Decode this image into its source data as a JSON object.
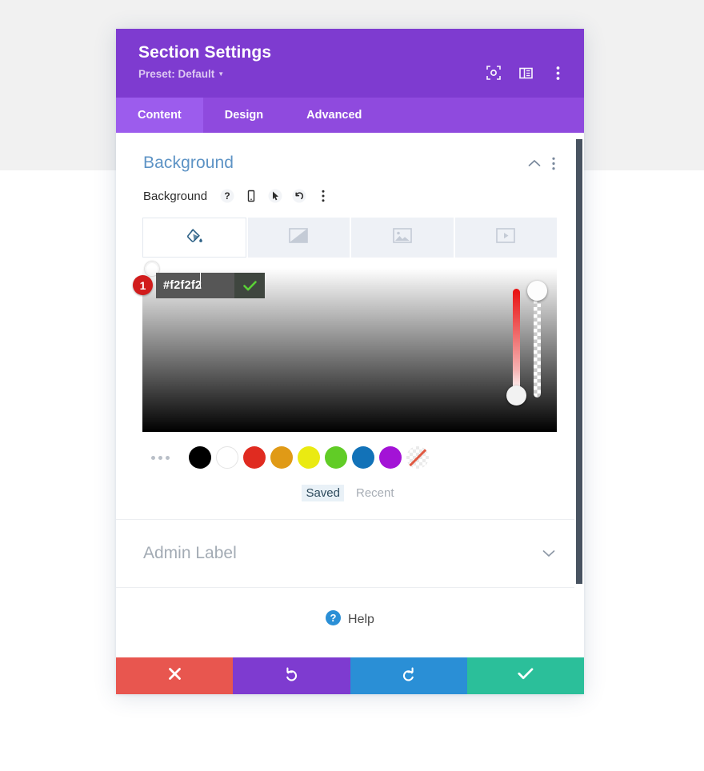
{
  "page": {
    "band_top_color": "#f1f1f1",
    "band_bottom_color": "#ffffff"
  },
  "modal": {
    "header": {
      "title": "Section Settings",
      "preset_label": "Preset: Default",
      "bg_color": "#7e3bd0",
      "icons": [
        {
          "name": "focus-expand-icon"
        },
        {
          "name": "layout-panel-icon"
        },
        {
          "name": "more-vertical-icon"
        }
      ]
    },
    "tabs": [
      {
        "label": "Content",
        "active": true
      },
      {
        "label": "Design",
        "active": false
      },
      {
        "label": "Advanced",
        "active": false
      }
    ],
    "tab_bar_color": "#8f4ade",
    "tab_active_color": "#9c5ced"
  },
  "background_section": {
    "title": "Background",
    "title_color": "#5d93c5",
    "collapse_icon": "chevron-up-icon",
    "more_icon": "more-vertical-icon",
    "field": {
      "label": "Background",
      "icons": [
        {
          "name": "help-question-icon"
        },
        {
          "name": "responsive-mobile-icon"
        },
        {
          "name": "hover-cursor-icon"
        },
        {
          "name": "reset-undo-icon"
        },
        {
          "name": "more-vertical-icon"
        }
      ]
    },
    "bg_types": [
      {
        "name": "background-color-tab",
        "icon": "paint-bucket-icon",
        "active": true
      },
      {
        "name": "background-gradient-tab",
        "icon": "gradient-icon",
        "active": false
      },
      {
        "name": "background-image-tab",
        "icon": "image-icon",
        "active": false
      },
      {
        "name": "background-video-tab",
        "icon": "video-icon",
        "active": false
      }
    ],
    "color_picker": {
      "hex_value": "#f2f2f2",
      "hex_placeholder": "#ffffff",
      "confirm_icon": "checkmark-icon",
      "confirm_color": "#5ad136",
      "step_badge": "1",
      "step_badge_color": "#d11c1c",
      "hue_slider_name": "hue-slider",
      "alpha_slider_name": "alpha-slider"
    },
    "swatches": [
      {
        "name": "swatch-more",
        "color": null
      },
      {
        "name": "swatch-black",
        "color": "#000000"
      },
      {
        "name": "swatch-white",
        "color": "#ffffff"
      },
      {
        "name": "swatch-red",
        "color": "#e02b20"
      },
      {
        "name": "swatch-orange",
        "color": "#e09a16"
      },
      {
        "name": "swatch-yellow",
        "color": "#eaea12"
      },
      {
        "name": "swatch-green",
        "color": "#61cc26"
      },
      {
        "name": "swatch-blue",
        "color": "#1272b8"
      },
      {
        "name": "swatch-purple",
        "color": "#a313d6"
      },
      {
        "name": "swatch-transparent",
        "color": "transparent"
      }
    ],
    "palette_tabs": [
      {
        "label": "Saved",
        "active": true
      },
      {
        "label": "Recent",
        "active": false
      }
    ]
  },
  "admin_label_section": {
    "title": "Admin Label",
    "expand_icon": "chevron-down-icon"
  },
  "help": {
    "label": "Help",
    "icon": "help-question-circle-icon",
    "icon_color": "#2a8fd6"
  },
  "footer": {
    "buttons": [
      {
        "name": "cancel-button",
        "icon": "close-x-icon",
        "color": "#e8564f"
      },
      {
        "name": "undo-button",
        "icon": "undo-arrow-icon",
        "color": "#7e3bd0"
      },
      {
        "name": "redo-button",
        "icon": "redo-arrow-icon",
        "color": "#2a8fd6"
      },
      {
        "name": "save-button",
        "icon": "checkmark-icon",
        "color": "#2bbf9a"
      }
    ]
  },
  "scrollbar": {
    "name": "modal-scrollbar",
    "thumb_color": "#485361"
  }
}
